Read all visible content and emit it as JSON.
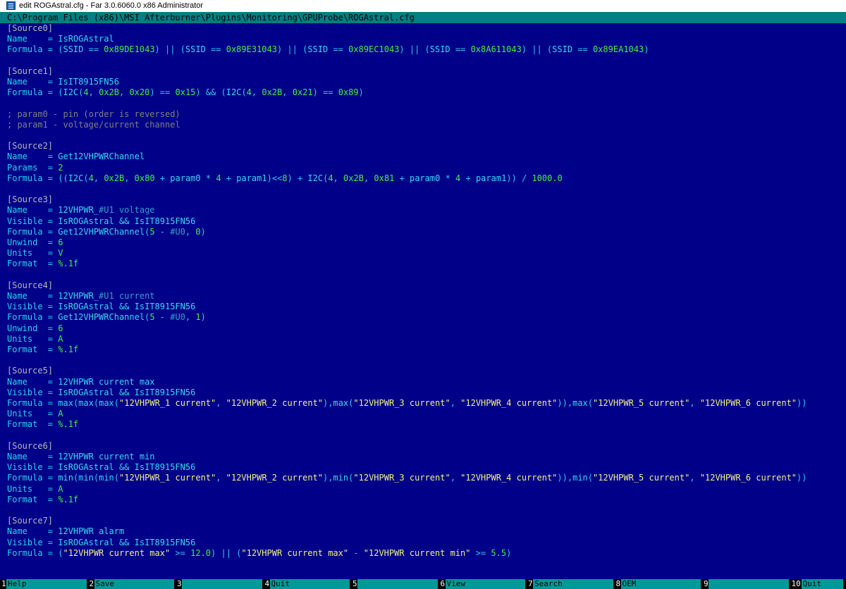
{
  "window": {
    "title": "edit ROGAstral.cfg - Far 3.0.6060.0 x86 Administrator"
  },
  "editor": {
    "file_path": "C:\\Program Files (x86)\\MSI Afterburner\\Plugins\\Monitoring\\GPUProbe\\ROGAstral.cfg"
  },
  "lines": [
    [
      [
        "sec",
        "[Source0]"
      ]
    ],
    [
      [
        "key",
        "Name    = "
      ],
      [
        "str",
        "IsROGAstral"
      ]
    ],
    [
      [
        "key",
        "Formula = ("
      ],
      [
        "str",
        "SSID"
      ],
      [
        "op",
        " == "
      ],
      [
        "num",
        "0x89DE1043"
      ],
      [
        "op",
        ") || ("
      ],
      [
        "str",
        "SSID"
      ],
      [
        "op",
        " == "
      ],
      [
        "num",
        "0x89E31043"
      ],
      [
        "op",
        ") || ("
      ],
      [
        "str",
        "SSID"
      ],
      [
        "op",
        " == "
      ],
      [
        "num",
        "0x89EC1043"
      ],
      [
        "op",
        ") || ("
      ],
      [
        "str",
        "SSID"
      ],
      [
        "op",
        " == "
      ],
      [
        "num",
        "0x8A611043"
      ],
      [
        "op",
        ") || ("
      ],
      [
        "str",
        "SSID"
      ],
      [
        "op",
        " == "
      ],
      [
        "num",
        "0x89EA1043"
      ],
      [
        "op",
        ")"
      ]
    ],
    [],
    [
      [
        "sec",
        "[Source1]"
      ]
    ],
    [
      [
        "key",
        "Name    = "
      ],
      [
        "str",
        "IsIT8915FN56"
      ]
    ],
    [
      [
        "key",
        "Formula = ("
      ],
      [
        "str",
        "I2C"
      ],
      [
        "op",
        "("
      ],
      [
        "num",
        "4"
      ],
      [
        "op",
        ", "
      ],
      [
        "num",
        "0x2B"
      ],
      [
        "op",
        ", "
      ],
      [
        "num",
        "0x20"
      ],
      [
        "op",
        ") == "
      ],
      [
        "num",
        "0x15"
      ],
      [
        "op",
        ") && ("
      ],
      [
        "str",
        "I2C"
      ],
      [
        "op",
        "("
      ],
      [
        "num",
        "4"
      ],
      [
        "op",
        ", "
      ],
      [
        "num",
        "0x2B"
      ],
      [
        "op",
        ", "
      ],
      [
        "num",
        "0x21"
      ],
      [
        "op",
        ") == "
      ],
      [
        "num",
        "0x89"
      ],
      [
        "op",
        ")"
      ]
    ],
    [],
    [
      [
        "cm",
        "; param0 - pin (order is reversed)"
      ]
    ],
    [
      [
        "cm",
        "; param1 - voltage/current channel"
      ]
    ],
    [],
    [
      [
        "sec",
        "[Source2]"
      ]
    ],
    [
      [
        "key",
        "Name    = "
      ],
      [
        "str",
        "Get12VHPWRChannel"
      ]
    ],
    [
      [
        "key",
        "Params  = "
      ],
      [
        "num",
        "2"
      ]
    ],
    [
      [
        "key",
        "Formula = (("
      ],
      [
        "str",
        "I2C"
      ],
      [
        "op",
        "("
      ],
      [
        "num",
        "4"
      ],
      [
        "op",
        ", "
      ],
      [
        "num",
        "0x2B"
      ],
      [
        "op",
        ", "
      ],
      [
        "num",
        "0x80"
      ],
      [
        "op",
        " + "
      ],
      [
        "str",
        "param0"
      ],
      [
        "op",
        " * "
      ],
      [
        "num",
        "4"
      ],
      [
        "op",
        " + "
      ],
      [
        "str",
        "param1"
      ],
      [
        "op",
        ")<<"
      ],
      [
        "num",
        "8"
      ],
      [
        "op",
        ") + "
      ],
      [
        "str",
        "I2C"
      ],
      [
        "op",
        "("
      ],
      [
        "num",
        "4"
      ],
      [
        "op",
        ", "
      ],
      [
        "num",
        "0x2B"
      ],
      [
        "op",
        ", "
      ],
      [
        "num",
        "0x81"
      ],
      [
        "op",
        " + "
      ],
      [
        "str",
        "param0"
      ],
      [
        "op",
        " * "
      ],
      [
        "num",
        "4"
      ],
      [
        "op",
        " + "
      ],
      [
        "str",
        "param1"
      ],
      [
        "op",
        ")) / "
      ],
      [
        "num",
        "1000.0"
      ]
    ],
    [],
    [
      [
        "sec",
        "[Source3]"
      ]
    ],
    [
      [
        "key",
        "Name    = "
      ],
      [
        "str",
        "12VHPWR_"
      ],
      [
        "var",
        "#U1 voltage"
      ]
    ],
    [
      [
        "key",
        "Visible = "
      ],
      [
        "str",
        "IsROGAstral && IsIT8915FN56"
      ]
    ],
    [
      [
        "key",
        "Formula = "
      ],
      [
        "str",
        "Get12VHPWRChannel"
      ],
      [
        "op",
        "("
      ],
      [
        "num",
        "5"
      ],
      [
        "op",
        " - "
      ],
      [
        "var",
        "#U0"
      ],
      [
        "op",
        ", "
      ],
      [
        "num",
        "0"
      ],
      [
        "op",
        ")"
      ]
    ],
    [
      [
        "key",
        "Unwind  = "
      ],
      [
        "num",
        "6"
      ]
    ],
    [
      [
        "key",
        "Units   = "
      ],
      [
        "num",
        "V"
      ]
    ],
    [
      [
        "key",
        "Format  = "
      ],
      [
        "num",
        "%.1f"
      ]
    ],
    [],
    [
      [
        "sec",
        "[Source4]"
      ]
    ],
    [
      [
        "key",
        "Name    = "
      ],
      [
        "str",
        "12VHPWR_"
      ],
      [
        "var",
        "#U1 current"
      ]
    ],
    [
      [
        "key",
        "Visible = "
      ],
      [
        "str",
        "IsROGAstral && IsIT8915FN56"
      ]
    ],
    [
      [
        "key",
        "Formula = "
      ],
      [
        "str",
        "Get12VHPWRChannel"
      ],
      [
        "op",
        "("
      ],
      [
        "num",
        "5"
      ],
      [
        "op",
        " - "
      ],
      [
        "var",
        "#U0"
      ],
      [
        "op",
        ", "
      ],
      [
        "num",
        "1"
      ],
      [
        "op",
        ")"
      ]
    ],
    [
      [
        "key",
        "Unwind  = "
      ],
      [
        "num",
        "6"
      ]
    ],
    [
      [
        "key",
        "Units   = "
      ],
      [
        "num",
        "A"
      ]
    ],
    [
      [
        "key",
        "Format  = "
      ],
      [
        "num",
        "%.1f"
      ]
    ],
    [],
    [
      [
        "sec",
        "[Source5]"
      ]
    ],
    [
      [
        "key",
        "Name    = "
      ],
      [
        "str",
        "12VHPWR current max"
      ]
    ],
    [
      [
        "key",
        "Visible = "
      ],
      [
        "str",
        "IsROGAstral && IsIT8915FN56"
      ]
    ],
    [
      [
        "key",
        "Formula = "
      ],
      [
        "str",
        "max"
      ],
      [
        "op",
        "("
      ],
      [
        "str",
        "max"
      ],
      [
        "op",
        "("
      ],
      [
        "str",
        "max"
      ],
      [
        "op",
        "("
      ],
      [
        "ql",
        "\"12VHPWR_1 current\""
      ],
      [
        "op",
        ", "
      ],
      [
        "ql",
        "\"12VHPWR_2 current\""
      ],
      [
        "op",
        "),"
      ],
      [
        "str",
        "max"
      ],
      [
        "op",
        "("
      ],
      [
        "ql",
        "\"12VHPWR_3 current\""
      ],
      [
        "op",
        ", "
      ],
      [
        "ql",
        "\"12VHPWR_4 current\""
      ],
      [
        "op",
        ")),"
      ],
      [
        "str",
        "max"
      ],
      [
        "op",
        "("
      ],
      [
        "ql",
        "\"12VHPWR_5 current\""
      ],
      [
        "op",
        ", "
      ],
      [
        "ql",
        "\"12VHPWR_6 current\""
      ],
      [
        "op",
        "))"
      ]
    ],
    [
      [
        "key",
        "Units   = "
      ],
      [
        "num",
        "A"
      ]
    ],
    [
      [
        "key",
        "Format  = "
      ],
      [
        "num",
        "%.1f"
      ]
    ],
    [],
    [
      [
        "sec",
        "[Source6]"
      ]
    ],
    [
      [
        "key",
        "Name    = "
      ],
      [
        "str",
        "12VHPWR current min"
      ]
    ],
    [
      [
        "key",
        "Visible = "
      ],
      [
        "str",
        "IsROGAstral && IsIT8915FN56"
      ]
    ],
    [
      [
        "key",
        "Formula = "
      ],
      [
        "str",
        "min"
      ],
      [
        "op",
        "("
      ],
      [
        "str",
        "min"
      ],
      [
        "op",
        "("
      ],
      [
        "str",
        "min"
      ],
      [
        "op",
        "("
      ],
      [
        "ql",
        "\"12VHPWR_1 current\""
      ],
      [
        "op",
        ", "
      ],
      [
        "ql",
        "\"12VHPWR_2 current\""
      ],
      [
        "op",
        "),"
      ],
      [
        "str",
        "min"
      ],
      [
        "op",
        "("
      ],
      [
        "ql",
        "\"12VHPWR_3 current\""
      ],
      [
        "op",
        ", "
      ],
      [
        "ql",
        "\"12VHPWR_4 current\""
      ],
      [
        "op",
        ")),"
      ],
      [
        "str",
        "min"
      ],
      [
        "op",
        "("
      ],
      [
        "ql",
        "\"12VHPWR_5 current\""
      ],
      [
        "op",
        ", "
      ],
      [
        "ql",
        "\"12VHPWR_6 current\""
      ],
      [
        "op",
        "))"
      ]
    ],
    [
      [
        "key",
        "Units   = "
      ],
      [
        "num",
        "A"
      ]
    ],
    [
      [
        "key",
        "Format  = "
      ],
      [
        "num",
        "%.1f"
      ]
    ],
    [],
    [
      [
        "sec",
        "[Source7]"
      ]
    ],
    [
      [
        "key",
        "Name    = "
      ],
      [
        "str",
        "12VHPWR alarm"
      ]
    ],
    [
      [
        "key",
        "Visible = "
      ],
      [
        "str",
        "IsROGAstral && IsIT8915FN56"
      ]
    ],
    [
      [
        "key",
        "Formula = ("
      ],
      [
        "ql",
        "\"12VHPWR current max\""
      ],
      [
        "op",
        " >= "
      ],
      [
        "num",
        "12.0"
      ],
      [
        "op",
        ") || ("
      ],
      [
        "ql",
        "\"12VHPWR current max\""
      ],
      [
        "op",
        " - "
      ],
      [
        "ql",
        "\"12VHPWR current min\""
      ],
      [
        "op",
        " >= "
      ],
      [
        "num",
        "5.5"
      ],
      [
        "op",
        ")"
      ]
    ]
  ],
  "keybar": [
    {
      "num": "1",
      "label": "Help"
    },
    {
      "num": "2",
      "label": "Save"
    },
    {
      "num": "3",
      "label": ""
    },
    {
      "num": "4",
      "label": "Quit"
    },
    {
      "num": "5",
      "label": ""
    },
    {
      "num": "6",
      "label": "View"
    },
    {
      "num": "7",
      "label": "Search"
    },
    {
      "num": "8",
      "label": "OEM"
    },
    {
      "num": "9",
      "label": ""
    },
    {
      "num": "10",
      "label": "Quit"
    }
  ]
}
